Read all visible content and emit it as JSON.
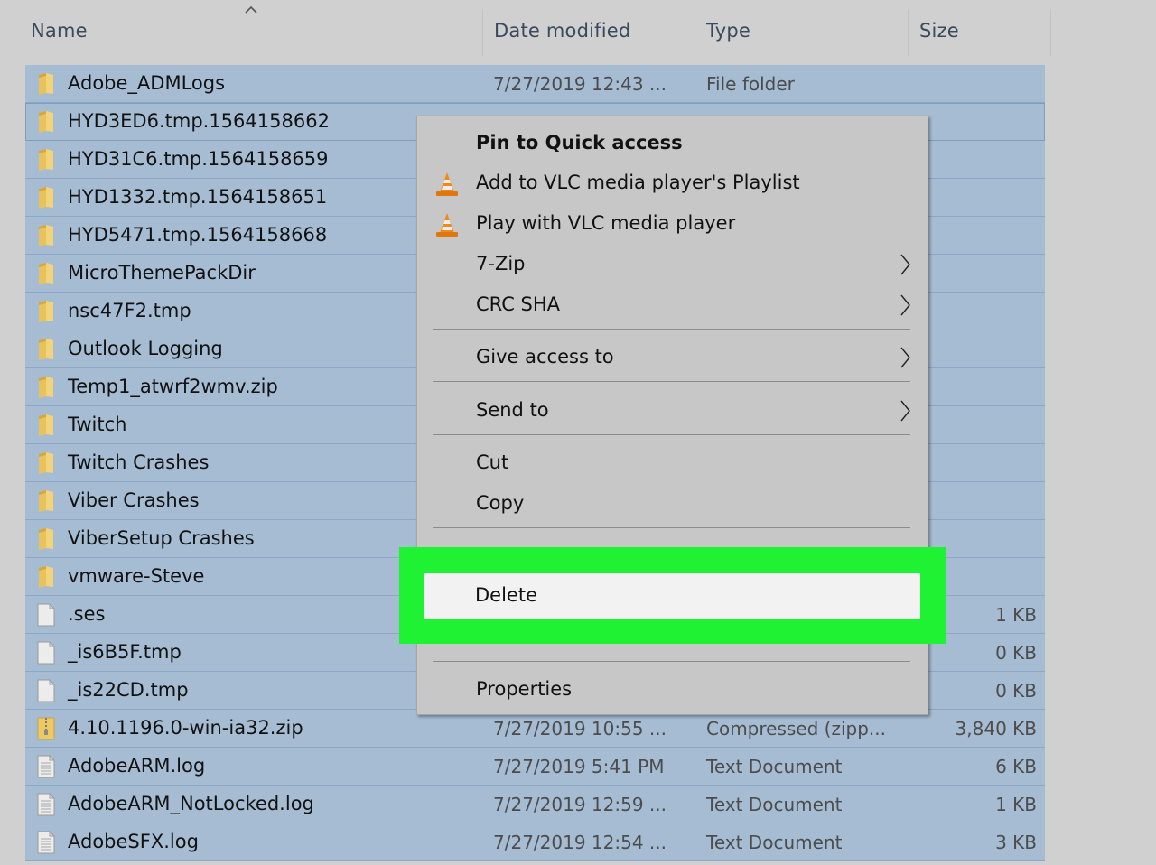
{
  "header": {
    "sort_indicator": "chevron-up-icon",
    "columns": [
      {
        "key": "name",
        "label": "Name"
      },
      {
        "key": "date",
        "label": "Date modified"
      },
      {
        "key": "type",
        "label": "Type"
      },
      {
        "key": "size",
        "label": "Size"
      }
    ]
  },
  "files": [
    {
      "name": "Adobe_ADMLogs",
      "date": "7/27/2019 12:43 ...",
      "type": "File folder",
      "size": "",
      "icon": "folder"
    },
    {
      "name": "HYD3ED6.tmp.1564158662",
      "date": "",
      "type": "",
      "size": "",
      "icon": "folder",
      "focused": true
    },
    {
      "name": "HYD31C6.tmp.1564158659",
      "date": "",
      "type": "",
      "size": "",
      "icon": "folder"
    },
    {
      "name": "HYD1332.tmp.1564158651",
      "date": "",
      "type": "",
      "size": "",
      "icon": "folder"
    },
    {
      "name": "HYD5471.tmp.1564158668",
      "date": "",
      "type": "",
      "size": "",
      "icon": "folder"
    },
    {
      "name": "MicroThemePackDir",
      "date": "",
      "type": "",
      "size": "",
      "icon": "folder"
    },
    {
      "name": "nsc47F2.tmp",
      "date": "",
      "type": "",
      "size": "",
      "icon": "folder"
    },
    {
      "name": "Outlook Logging",
      "date": "",
      "type": "",
      "size": "",
      "icon": "folder"
    },
    {
      "name": "Temp1_atwrf2wmv.zip",
      "date": "",
      "type": "",
      "size": "",
      "icon": "folder"
    },
    {
      "name": "Twitch",
      "date": "",
      "type": "",
      "size": "",
      "icon": "folder"
    },
    {
      "name": "Twitch Crashes",
      "date": "",
      "type": "",
      "size": "",
      "icon": "folder"
    },
    {
      "name": "Viber Crashes",
      "date": "",
      "type": "",
      "size": "",
      "icon": "folder"
    },
    {
      "name": "ViberSetup Crashes",
      "date": "",
      "type": "",
      "size": "",
      "icon": "folder"
    },
    {
      "name": "vmware-Steve",
      "date": "",
      "type": "",
      "size": "",
      "icon": "folder"
    },
    {
      "name": ".ses",
      "date": "",
      "type": "",
      "size": "1 KB",
      "icon": "blank-file"
    },
    {
      "name": "_is6B5F.tmp",
      "date": "",
      "type": "",
      "size": "0 KB",
      "icon": "blank-file"
    },
    {
      "name": "_is22CD.tmp",
      "date": "",
      "type": "",
      "size": "0 KB",
      "icon": "blank-file"
    },
    {
      "name": "4.10.1196.0-win-ia32.zip",
      "date": "7/27/2019 10:55 ...",
      "type": "Compressed (zipp...",
      "size": "3,840 KB",
      "icon": "zip"
    },
    {
      "name": "AdobeARM.log",
      "date": "7/27/2019 5:41 PM",
      "type": "Text Document",
      "size": "6 KB",
      "icon": "text-file"
    },
    {
      "name": "AdobeARM_NotLocked.log",
      "date": "7/27/2019 12:59 ...",
      "type": "Text Document",
      "size": "1 KB",
      "icon": "text-file"
    },
    {
      "name": "AdobeSFX.log",
      "date": "7/27/2019 12:54 ...",
      "type": "Text Document",
      "size": "3 KB",
      "icon": "text-file"
    }
  ],
  "context_menu": {
    "items": [
      {
        "label": "Pin to Quick access",
        "bold": true
      },
      {
        "label": "Add to VLC media player's Playlist",
        "icon": "vlc-cone"
      },
      {
        "label": "Play with VLC media player",
        "icon": "vlc-cone"
      },
      {
        "label": "7-Zip",
        "submenu": true
      },
      {
        "label": "CRC SHA",
        "submenu": true
      },
      {
        "label": "Give access to",
        "submenu": true
      },
      {
        "label": "Send to",
        "submenu": true
      },
      {
        "label": "Cut"
      },
      {
        "label": "Copy"
      },
      {
        "label": "Delete",
        "highlighted": true
      },
      {
        "label": "Properties"
      }
    ]
  },
  "colors": {
    "selection": "#a6bcd2",
    "menu_bg": "#c7c7c7",
    "highlight_frame": "#1ff232",
    "highlight_item": "#f2f2f2"
  }
}
